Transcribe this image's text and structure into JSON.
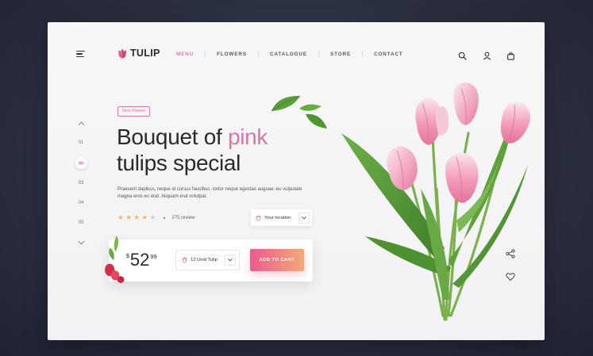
{
  "brand": {
    "name": "TULIP",
    "logo_icon": "tulip-logo-icon"
  },
  "nav": {
    "items": [
      {
        "label": "MENU",
        "active": true
      },
      {
        "label": "FLOWERS",
        "active": false
      },
      {
        "label": "CATALOGUE",
        "active": false
      },
      {
        "label": "STORE",
        "active": false
      },
      {
        "label": "CONTACT",
        "active": false
      }
    ]
  },
  "header_icons": [
    "search-icon",
    "user-icon",
    "cart-icon"
  ],
  "slider": {
    "numbers": [
      "01",
      "03",
      "04",
      "05"
    ],
    "active_index": 2
  },
  "hero": {
    "badge": "New Flower",
    "title_line1_plain": "Bouquet of ",
    "title_line1_accent": "pink",
    "title_line2": "tulips special",
    "description": "Praesent dapibus, neque id cursus faucibus, tortor neque egestas auguae, eu vulputate magna eros eu erat. Aliquam erat volutpat."
  },
  "rating": {
    "stars": 4,
    "max": 5,
    "review_text": "275 review"
  },
  "location": {
    "label": "Your location"
  },
  "purchase": {
    "currency": "$",
    "price_main": "52",
    "price_cents": "99",
    "quantity_label": "12 Unid Tulip",
    "cta": "ADD TO CART"
  },
  "side_icons": [
    "share-icon",
    "heart-icon"
  ],
  "colors": {
    "accent": "#e47aa5",
    "cta_start": "#ec5b8d",
    "cta_end": "#f2a97a",
    "star": "#f2c041"
  }
}
